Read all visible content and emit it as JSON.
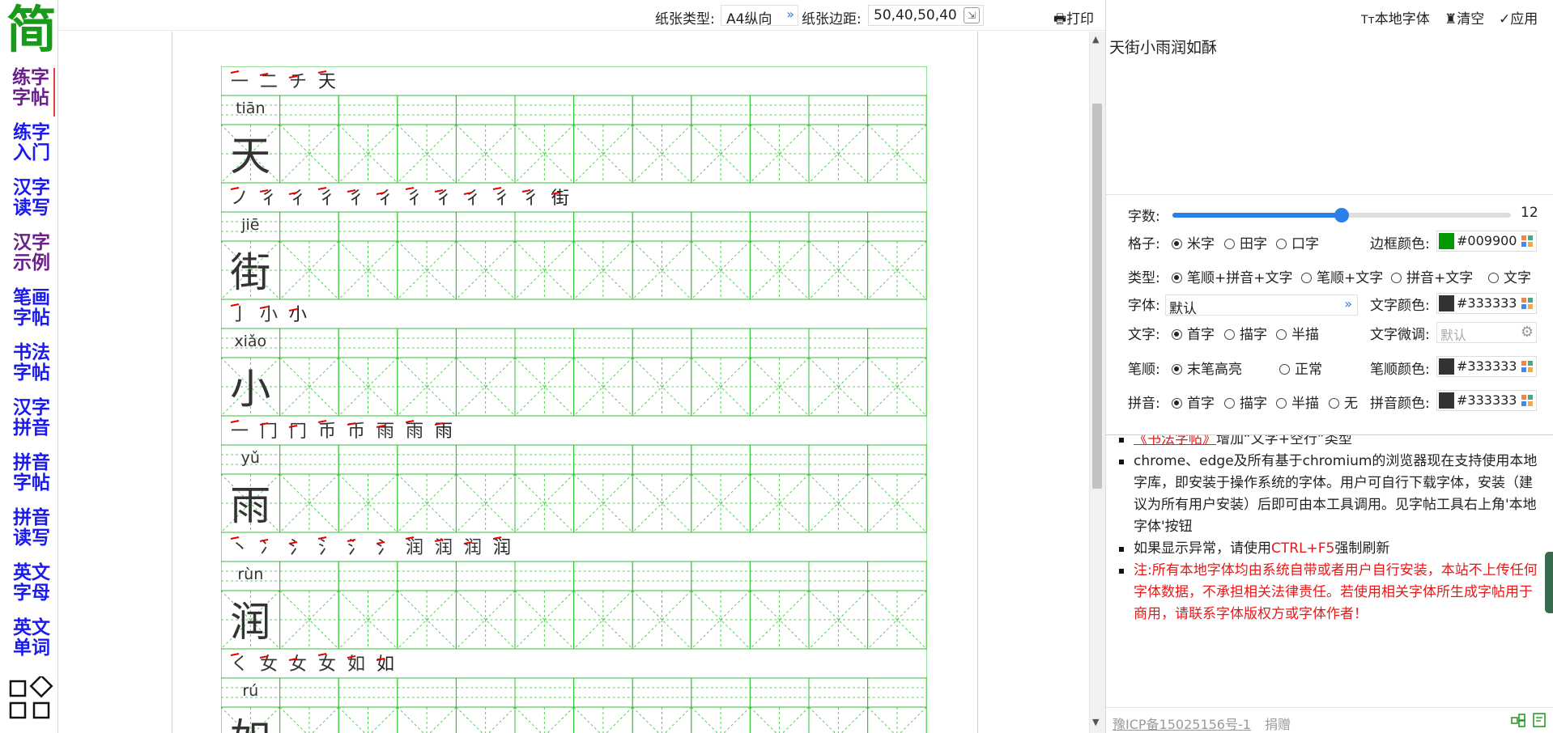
{
  "logo": "简",
  "nav": [
    {
      "label": [
        "练字",
        "字帖"
      ],
      "active": true
    },
    {
      "label": [
        "练字",
        "入门"
      ]
    },
    {
      "label": [
        "汉字",
        "读写"
      ]
    },
    {
      "label": [
        "汉字",
        "示例"
      ]
    },
    {
      "label": [
        "笔画",
        "字帖"
      ]
    },
    {
      "label": [
        "书法",
        "字帖"
      ]
    },
    {
      "label": [
        "汉字",
        "拼音"
      ]
    },
    {
      "label": [
        "拼音",
        "字帖"
      ]
    },
    {
      "label": [
        "拼音",
        "读写"
      ]
    },
    {
      "label": [
        "英文",
        "字母"
      ]
    },
    {
      "label": [
        "英文",
        "单词"
      ]
    }
  ],
  "toolbar": {
    "paper_type_label": "纸张类型:",
    "paper_type_value": "A4纵向",
    "margin_label": "纸张边距:",
    "margin_value": "50,40,50,40",
    "print_label": "打印"
  },
  "right_toolbar": {
    "local_font": "本地字体",
    "clear": "清空",
    "apply": "应用"
  },
  "input_text": "天街小雨润如酥",
  "settings": {
    "count_label": "字数:",
    "count_value": "12",
    "count_fraction": 0.5,
    "grid_label": "格子:",
    "grid_options": [
      "米字",
      "田字",
      "口字"
    ],
    "border_color_label": "边框颜色:",
    "border_color": "#009900",
    "type_label": "类型:",
    "type_options": [
      "笔顺+拼音+文字",
      "笔顺+文字",
      "拼音+文字",
      "文字"
    ],
    "font_label": "字体:",
    "font_value": "默认",
    "text_color_label": "文字颜色:",
    "text_color": "#333333",
    "text_label": "文字:",
    "text_options": [
      "首字",
      "描字",
      "半描"
    ],
    "adjust_label": "文字微调:",
    "adjust_placeholder": "默认",
    "stroke_label": "笔顺:",
    "stroke_options": [
      "末笔高亮",
      "正常"
    ],
    "stroke_color_label": "笔顺颜色:",
    "stroke_color": "#333333",
    "pinyin_label": "拼音:",
    "pinyin_options": [
      "首字",
      "描字",
      "半描",
      "无"
    ],
    "pinyin_color_label": "拼音颜色:",
    "pinyin_color": "#333333"
  },
  "notes": {
    "partial_link": "《书法字帖》",
    "partial_rest": "增加“文字+空行”类型",
    "chromium": "chrome、edge及所有基于chromium的浏览器现在支持使用本地字库，即安装于操作系统的字体。用户可自行下载字体，安装（建议为所有用户安装）后即可由本工具调用。见字帖工具右上角'本地字体'按钮",
    "refresh_pre": "如果显示异常，请使用",
    "refresh_key": "CTRL+F5",
    "refresh_post": "强制刷新",
    "disclaimer": "注:所有本地字体均由系统自带或者用户自行安装，本站不上传任何字体数据，不承担相关法律责任。若使用相关字体所生成字帖用于商用，请联系字体版权方或字体作者！"
  },
  "footer": {
    "icp": "豫ICP备15025156号-1",
    "donate": "捐赠"
  },
  "practice": {
    "grid_color": "#2fc02f",
    "stroke_highlight": "#e60000",
    "rows": [
      {
        "char": "天",
        "pinyin": "tiān",
        "strokes": [
          "一",
          "二",
          "チ",
          "天"
        ]
      },
      {
        "char": "街",
        "pinyin": "jiē",
        "strokes": [
          "ノ",
          "彳",
          "彳",
          "彳",
          "彳",
          "彳",
          "彳",
          "彳",
          "彳",
          "彳",
          "彳",
          "街"
        ]
      },
      {
        "char": "小",
        "pinyin": "xiǎo",
        "strokes": [
          "亅",
          "小",
          "小"
        ]
      },
      {
        "char": "雨",
        "pinyin": "yǔ",
        "strokes": [
          "一",
          "冂",
          "冂",
          "币",
          "币",
          "雨",
          "雨",
          "雨"
        ]
      },
      {
        "char": "润",
        "pinyin": "rùn",
        "strokes": [
          "丶",
          "冫",
          "氵",
          "氵",
          "氵",
          "氵",
          "润",
          "润",
          "润",
          "润"
        ]
      },
      {
        "char": "如",
        "pinyin": "rú",
        "strokes": [
          "く",
          "女",
          "女",
          "女",
          "如",
          "如"
        ]
      }
    ]
  }
}
